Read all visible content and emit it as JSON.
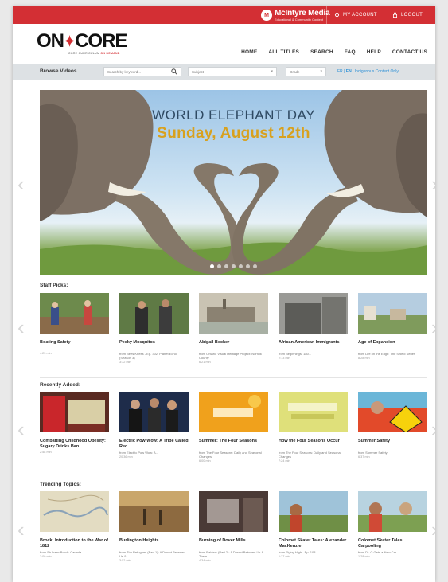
{
  "topbar": {
    "brand_mark": "M",
    "brand_name": "McIntyre Media",
    "brand_sub": "Educational & Community Content",
    "my_account": "MY ACCOUNT",
    "logout": "LOGOUT"
  },
  "logo": {
    "left": "ON",
    "right": "CORE",
    "tagline_a": "CORE CURRICULUM",
    "tagline_b": "ON DEMAND"
  },
  "nav": [
    "HOME",
    "ALL TITLES",
    "SEARCH",
    "FAQ",
    "HELP",
    "CONTACT US"
  ],
  "browse": {
    "label": "Browse Videos",
    "search_placeholder": "Search by keyword...",
    "subject": "Subject",
    "grade": "Grade",
    "lang_fr": "FR",
    "lang_en": "EN",
    "indigenous": "Indigenous Content Only"
  },
  "hero": {
    "title": "WORLD ELEPHANT DAY",
    "subtitle": "Sunday, August 12th",
    "slides": 7,
    "active_slide": 1
  },
  "sections": [
    {
      "title": "Staff Picks:",
      "cards": [
        {
          "title": "Boating Safety",
          "desc": "",
          "dur": "4:23 min"
        },
        {
          "title": "Pesky Mosquitos",
          "desc": "from Bees Knees - Ep. 302: Planet Echo (Season 3)",
          "dur": "3:32 min"
        },
        {
          "title": "Abigail Becker",
          "desc": "from Ontario Visual Heritage Project: Norfolk County",
          "dur": "6:21 min"
        },
        {
          "title": "African American Immigrants",
          "desc": "from Beginnings: 180...",
          "dur": "2:13 min"
        },
        {
          "title": "Age of Expansion",
          "desc": "from Life on the Edge: The Shield Series",
          "dur": "8:28 min"
        }
      ]
    },
    {
      "title": "Recently Added:",
      "cards": [
        {
          "title": "Combatting Childhood Obesity: Sugary Drinks Ban",
          "desc": "",
          "dur": "2:58 min"
        },
        {
          "title": "Electric Pow Wow: A Tribe Called Red",
          "desc": "from Electric Pow Wow: A...",
          "dur": "20:36 min"
        },
        {
          "title": "Summer: The Four Seasons",
          "desc": "from The Four Seasons: Daily and Seasonal Changes",
          "dur": "6:00 min"
        },
        {
          "title": "How the Four Seasons Occur",
          "desc": "from The Four Seasons: Daily and Seasonal Changes",
          "dur": "7:24 min"
        },
        {
          "title": "Summer Safety",
          "desc": "from Summer Safety",
          "dur": "6:37 min"
        }
      ]
    },
    {
      "title": "Trending Topics:",
      "cards": [
        {
          "title": "Brock: Introduction to the War of 1812",
          "desc": "from Sir Isaac Brock: Canada...",
          "dur": "2:00 min"
        },
        {
          "title": "Burlington Heights",
          "desc": "from The Refugees (Part 1): A Desert Between Us &...",
          "dur": "3:52 min"
        },
        {
          "title": "Burning of Dover Mills",
          "desc": "from Raiders (Part 2): A Desert Between Us & Them",
          "dur": "4:34 min"
        },
        {
          "title": "Colomet Skater Tales: Alexander MacKenzie",
          "desc": "from Flying High - Ep. 108...",
          "dur": "1:37 min"
        },
        {
          "title": "Colomet Skater Tales: Carpooling",
          "desc": "from Dr. G Gets a New Car...",
          "dur": "1:28 min"
        }
      ]
    }
  ]
}
